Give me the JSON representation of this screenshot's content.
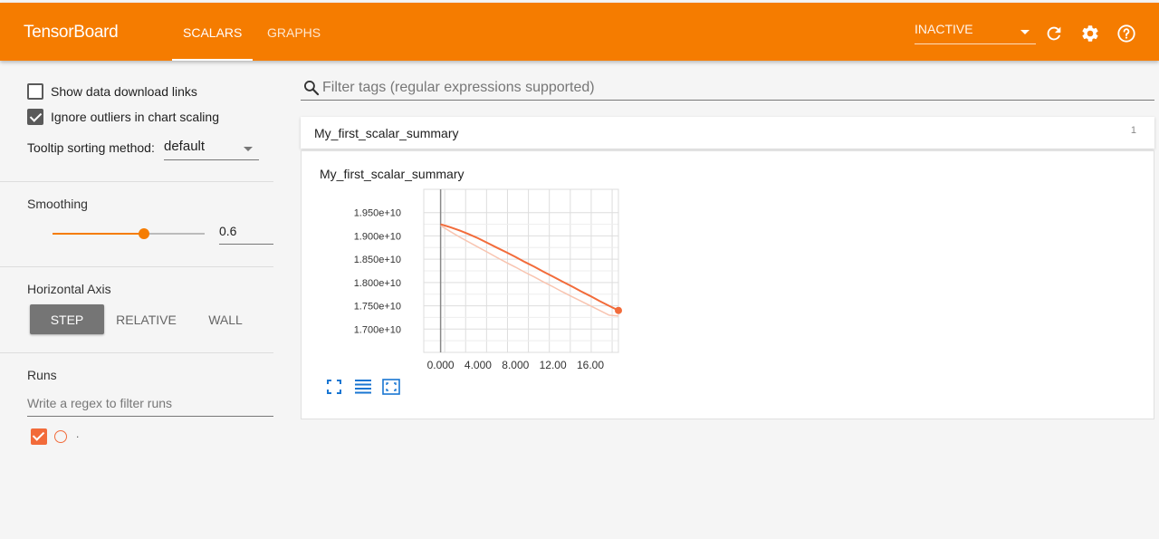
{
  "header": {
    "brand": "TensorBoard",
    "tabs": [
      {
        "label": "SCALARS",
        "active": true
      },
      {
        "label": "GRAPHS",
        "active": false
      }
    ],
    "run_state": "INACTIVE",
    "icons": [
      "refresh-icon",
      "settings-icon",
      "help-icon"
    ],
    "accent_color": "#f57c00"
  },
  "sidebar": {
    "show_download_links": {
      "label": "Show data download links",
      "checked": false
    },
    "ignore_outliers": {
      "label": "Ignore outliers in chart scaling",
      "checked": true
    },
    "tooltip_sorting": {
      "label": "Tooltip sorting method:",
      "value": "default"
    },
    "smoothing": {
      "title": "Smoothing",
      "value": "0.6",
      "fraction": 0.6
    },
    "horizontal_axis": {
      "title": "Horizontal Axis",
      "options": [
        "STEP",
        "RELATIVE",
        "WALL"
      ],
      "selected": "STEP"
    },
    "runs": {
      "title": "Runs",
      "filter_placeholder": "Write a regex to filter runs",
      "items": [
        {
          "name": ".",
          "checked": true,
          "color": "#f26b3a"
        }
      ]
    }
  },
  "main": {
    "filter_placeholder": "Filter tags (regular expressions supported)",
    "category": {
      "name": "My_first_scalar_summary",
      "count": "1"
    },
    "card": {
      "title": "My_first_scalar_summary"
    }
  },
  "chart_data": {
    "type": "line",
    "title": "My_first_scalar_summary",
    "xlabel": "",
    "ylabel": "",
    "x_ticks": [
      "0.000",
      "4.000",
      "8.000",
      "12.00",
      "16.00"
    ],
    "y_ticks": [
      "1.950e+10",
      "1.900e+10",
      "1.850e+10",
      "1.800e+10",
      "1.750e+10",
      "1.700e+10"
    ],
    "xlim": [
      -1.8,
      19
    ],
    "ylim": [
      16.5,
      20.0
    ],
    "y_scale_note": "values in units of 1e+10",
    "grid": true,
    "series": [
      {
        "name": "",
        "role": "smoothed",
        "color": "#f26b3a",
        "x": [
          0,
          1,
          2,
          3,
          4,
          5,
          6,
          7,
          8,
          9,
          10,
          11,
          12,
          13,
          14,
          15,
          16,
          17,
          18,
          19
        ],
        "y": [
          19.25,
          19.19,
          19.12,
          19.04,
          18.95,
          18.85,
          18.75,
          18.65,
          18.55,
          18.44,
          18.34,
          18.23,
          18.13,
          18.02,
          17.92,
          17.81,
          17.71,
          17.6,
          17.5,
          17.4
        ]
      },
      {
        "name": "",
        "role": "raw",
        "color": "#f8c4b0",
        "x": [
          0,
          1,
          2,
          3,
          4,
          5,
          6,
          7,
          8,
          9,
          10,
          11,
          12,
          13,
          14,
          15,
          16,
          17,
          18,
          19
        ],
        "y": [
          19.22,
          19.1,
          18.98,
          18.87,
          18.76,
          18.65,
          18.54,
          18.43,
          18.33,
          18.22,
          18.12,
          18.01,
          17.91,
          17.8,
          17.7,
          17.6,
          17.5,
          17.4,
          17.3,
          17.28
        ]
      }
    ]
  }
}
